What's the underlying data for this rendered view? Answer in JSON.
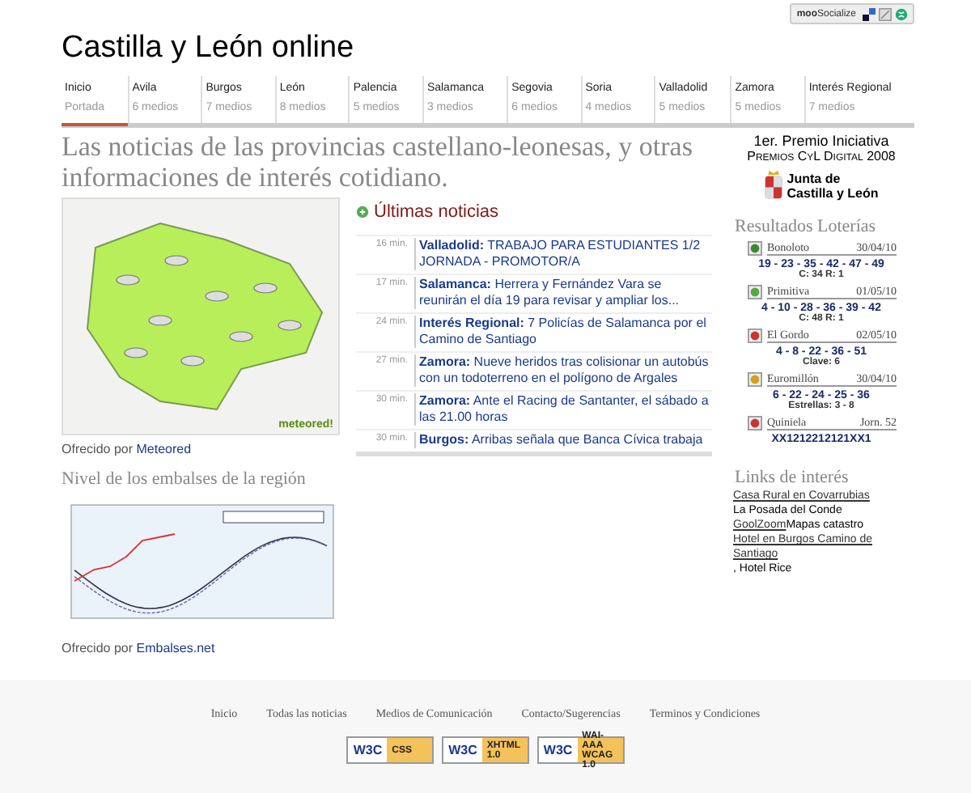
{
  "socialize": {
    "label": "**moo**Socialize"
  },
  "site_title": "Castilla y León online",
  "tabs": [
    {
      "label": "Inicio",
      "sub": "Portada",
      "selected": true
    },
    {
      "label": "Avila",
      "sub": "6 medios",
      "selected": false
    },
    {
      "label": "Burgos",
      "sub": "7 medios",
      "selected": false
    },
    {
      "label": "León",
      "sub": "8 medios",
      "selected": false
    },
    {
      "label": "Palencia",
      "sub": "5 medios",
      "selected": false
    },
    {
      "label": "Salamanca",
      "sub": "3 medios",
      "selected": false
    },
    {
      "label": "Segovia",
      "sub": "6 medios",
      "selected": false
    },
    {
      "label": "Soria",
      "sub": "4 medios",
      "selected": false
    },
    {
      "label": "Valladolid",
      "sub": "5 medios",
      "selected": false
    },
    {
      "label": "Zamora",
      "sub": "5 medios",
      "selected": false
    },
    {
      "label": "Interés Regional",
      "sub": "7 medios",
      "selected": false
    }
  ],
  "headline": "Las noticias de las provincias castellano-leonesas, y otras informaciones de interés cotidiano.",
  "weather": {
    "credit_prefix": "Ofrecido por",
    "credit_link": "Meteored",
    "logo": "meteored!"
  },
  "news": {
    "title": "Últimas noticias",
    "items": [
      {
        "time": "16 min.",
        "region": "Valladolid:",
        "text": "TRABAJO PARA ESTUDIANTES 1/2 JORNADA - PROMOTOR/A"
      },
      {
        "time": "17 min.",
        "region": "Salamanca:",
        "text": "Herrera y Fernández Vara se reunirán el día 19 para revisar y ampliar los..."
      },
      {
        "time": "24 min.",
        "region": "Interés Regional:",
        "text": "7 Policías de Salamanca por el Camino de Santiago"
      },
      {
        "time": "27 min.",
        "region": "Zamora:",
        "text": "Nueve heridos tras colisionar un autobús con un todoterreno en el polígono de Argales"
      },
      {
        "time": "30 min.",
        "region": "Zamora:",
        "text": "Ante el Racing de Santanter, el sábado a las 21.00 horas"
      },
      {
        "time": "30 min.",
        "region": "Burgos:",
        "text": "Arribas señala que Banca Cívica trabaja"
      }
    ]
  },
  "reservoirs": {
    "title": "Nivel de los embalses de la región",
    "credit_prefix": "Ofrecido por",
    "credit_link": "Embalses.net"
  },
  "award": {
    "line1": "1er. Premio Iniciativa",
    "line2": "Premios CyL Digital 2008",
    "logo_line1": "Junta de",
    "logo_line2": "Castilla y León"
  },
  "lotteries": {
    "title": "Resultados Loterías",
    "items": [
      {
        "name": "Bonoloto",
        "date": "30/04/10",
        "numbers": "19 - 23 - 35 - 42 - 47 - 49",
        "extra": "C: 34 R: 1",
        "color": "#3a8a3a"
      },
      {
        "name": "Primitiva",
        "date": "01/05/10",
        "numbers": "4 - 10 - 28 - 36 - 39 - 42",
        "extra": "C: 48 R: 1",
        "color": "#55aa44"
      },
      {
        "name": "El Gordo",
        "date": "02/05/10",
        "numbers": "4 - 8 - 22 - 36 - 51",
        "extra": "Clave: 6",
        "color": "#cc3333"
      },
      {
        "name": "Euromillón",
        "date": "30/04/10",
        "numbers": "6 - 22 - 24 - 25 - 36",
        "extra": "Estrellas: 3 - 8",
        "color": "#d4a020"
      },
      {
        "name": "Quiniela",
        "date": "Jorn. 52",
        "numbers": "XX1212212121XX1",
        "color": "#cc3333"
      }
    ]
  },
  "links": {
    "title": "Links de interés",
    "items": [
      {
        "link": "Casa Rural en Covarrubias",
        "text": " La Posada del Conde"
      },
      {
        "link": "GoolZoom",
        "text": " Mapas catastro"
      },
      {
        "link": "Hotel en Burgos Camino de Santiago",
        "text": ", Hotel Rice"
      }
    ]
  },
  "footer": {
    "links": [
      "Inicio",
      "Todas las noticias",
      "Medios de Comunicación",
      "Contacto/Sugerencias",
      "Terminos y Condiciones"
    ],
    "badges": [
      {
        "logo": "W3C",
        "label": "CSS"
      },
      {
        "logo": "W3C",
        "label": "XHTML 1.0"
      },
      {
        "logo": "W3C",
        "label": "WAI-AAA WCAG 1.0"
      }
    ]
  }
}
